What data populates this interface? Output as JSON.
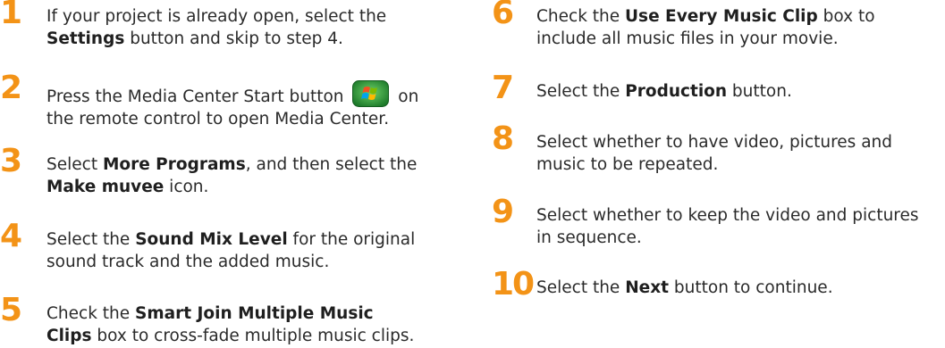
{
  "accent_color": "#f39317",
  "steps_left": [
    {
      "num": "1",
      "parts": [
        [
          "If your project is already open, select the"
        ],
        [
          {
            "b": "Settings"
          },
          " button and skip to step 4."
        ]
      ]
    },
    {
      "num": "2",
      "parts": [
        [
          "Press the Media Center Start button ",
          {
            "icon": "windows-start-icon"
          },
          " on"
        ],
        [
          "the remote control to open Media Center."
        ]
      ]
    },
    {
      "num": "3",
      "parts": [
        [
          "Select ",
          {
            "b": "More Programs"
          },
          ", and then select the"
        ],
        [
          {
            "b": "Make muvee"
          },
          " icon."
        ]
      ]
    },
    {
      "num": "4",
      "parts": [
        [
          "Select the ",
          {
            "b": "Sound Mix Level"
          },
          " for the original"
        ],
        [
          "sound track and the added music."
        ]
      ]
    },
    {
      "num": "5",
      "parts": [
        [
          "Check the ",
          {
            "b": "Smart Join Multiple Music"
          }
        ],
        [
          {
            "b": "Clips"
          },
          " box to cross-fade multiple music clips."
        ]
      ]
    }
  ],
  "steps_right": [
    {
      "num": "6",
      "parts": [
        [
          "Check the ",
          {
            "b": "Use Every Music Clip"
          },
          " box to"
        ],
        [
          "include all music files in your movie."
        ]
      ]
    },
    {
      "num": "7",
      "parts": [
        [
          "Select the ",
          {
            "b": "Production"
          },
          " button."
        ]
      ]
    },
    {
      "num": "8",
      "parts": [
        [
          "Select whether to have video, pictures and"
        ],
        [
          "music to be repeated."
        ]
      ]
    },
    {
      "num": "9",
      "parts": [
        [
          "Select whether to keep the video and pictures"
        ],
        [
          "in sequence."
        ]
      ]
    },
    {
      "num": "10",
      "parts": [
        [
          "Select the ",
          {
            "b": "Next"
          },
          " button to continue."
        ]
      ]
    }
  ]
}
